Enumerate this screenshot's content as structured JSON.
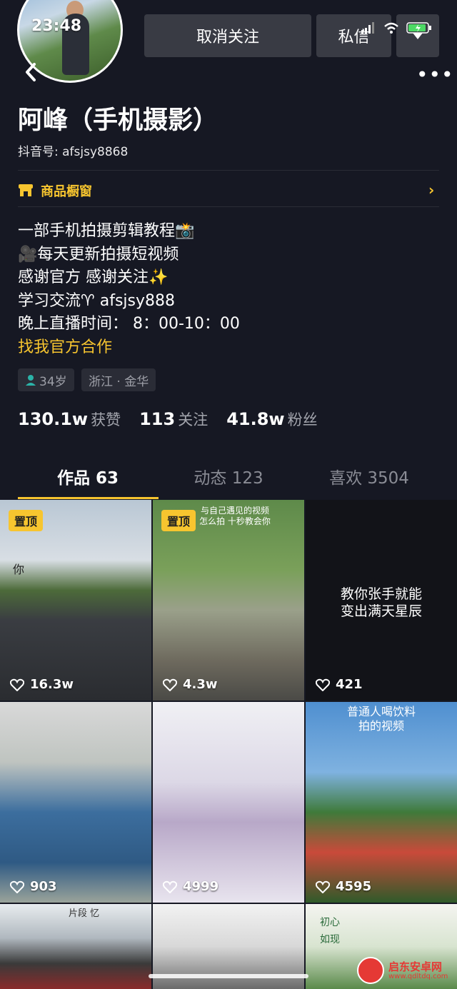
{
  "status_bar": {
    "time": "23:48"
  },
  "header": {
    "back_icon": "chevron-left-icon",
    "unfollow_label": "取消关注",
    "message_label": "私信",
    "more_icon": "more-dots-icon"
  },
  "profile": {
    "name": "阿峰（手机摄影）",
    "douyin_id": "抖音号: afsjsy8868",
    "shop_label": "商品橱窗",
    "bio_lines": [
      "一部手机拍摄剪辑教程📸",
      "🎥每天更新拍摄短视频",
      "感谢官方  感谢关注✨",
      "学习交流♈ afsjsy888",
      "晚上直播时间：  8：00-10：00"
    ],
    "bio_link": "找我官方合作",
    "age_tag": "34岁",
    "location_tag": "浙江 · 金华"
  },
  "stats": {
    "likes_value": "130.1w",
    "likes_label": "获赞",
    "following_value": "113",
    "following_label": "关注",
    "followers_value": "41.8w",
    "followers_label": "粉丝"
  },
  "tabs": [
    {
      "label": "作品 63"
    },
    {
      "label": "动态 123"
    },
    {
      "label": "喜欢 3504"
    }
  ],
  "videos": [
    {
      "likes": "16.3w",
      "pinned": "置顶",
      "overlay": "你"
    },
    {
      "likes": "4.3w",
      "pinned": "置顶",
      "overlay": "与自己遇见的视频 怎么拍 十秒教会你"
    },
    {
      "likes": "421",
      "overlay_line1": "教你张手就能",
      "overlay_line2": "变出满天星辰"
    },
    {
      "likes": "903"
    },
    {
      "likes": "4999"
    },
    {
      "likes": "4595",
      "overlay_line1": "普通人喝饮料",
      "overlay_line2": "拍的视频"
    },
    {
      "overlay": "片段 忆"
    },
    {},
    {
      "overlay": "初心 如现"
    }
  ],
  "watermark": {
    "title": "启东安卓网",
    "url": "www.qdltdq.com"
  },
  "colors": {
    "background": "#161823",
    "accent": "#f7c52f",
    "button": "#393b44"
  }
}
